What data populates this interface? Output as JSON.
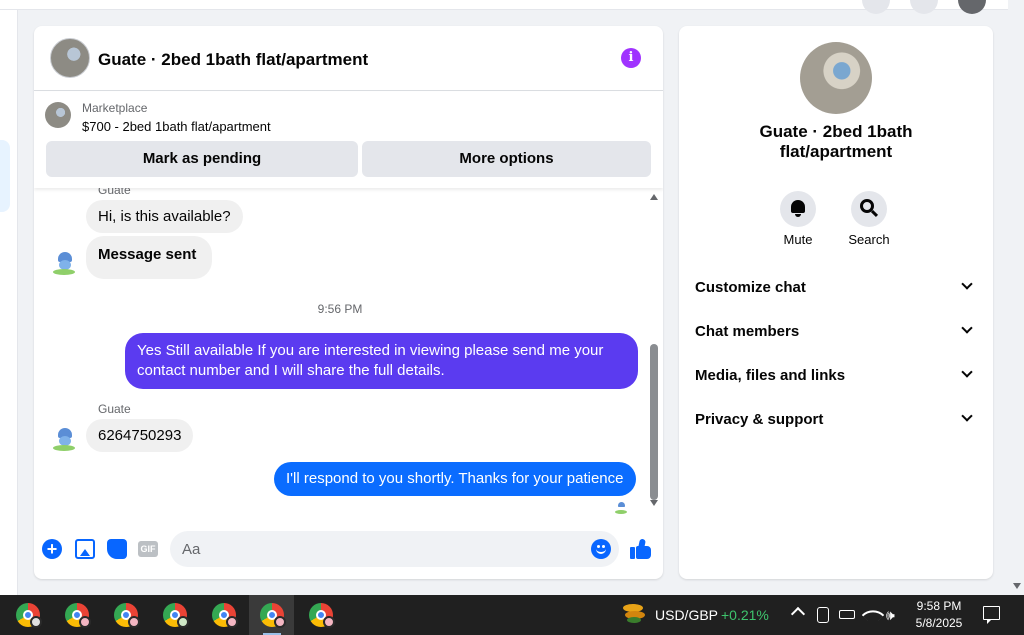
{
  "chat": {
    "title": "Guate · 2bed 1bath flat/apartment",
    "info_icon": "i"
  },
  "marketplace": {
    "label": "Marketplace",
    "listing": "$700 - 2bed 1bath flat/apartment",
    "mark_pending_label": "Mark as pending",
    "more_options_label": "More options"
  },
  "messages": {
    "sender_top_partial": "Guate",
    "msg1": "Hi, is this available?",
    "msg2": "Message sent",
    "timestamp": "9:56 PM",
    "msg3": "Yes Still available If you are interested in viewing please send me your contact number and I will share the full details.",
    "sender_name": "Guate",
    "msg4": "6264750293",
    "msg5": "I'll respond to you shortly. Thanks for your patience"
  },
  "composer": {
    "placeholder": "Aa",
    "gif_label": "GIF",
    "plus_label": "+"
  },
  "info_panel": {
    "title": "Guate · 2bed 1bath flat/apartment",
    "mute_label": "Mute",
    "search_label": "Search",
    "sections": [
      "Customize chat",
      "Chat members",
      "Media, files and links",
      "Privacy & support"
    ]
  },
  "taskbar": {
    "ticker_pair": "USD/GBP",
    "ticker_change": "+0.21%",
    "speaker_glyph": "🕪",
    "time": "9:58 PM",
    "date": "5/8/2025"
  },
  "colors": {
    "outgoing_purple": "#5b3bf0",
    "outgoing_blue": "#0a6cff",
    "incoming_gray": "#f0f0f0",
    "accent": "#0866ff",
    "info_purple": "#a033ff",
    "ticker_green": "#3ec46d"
  }
}
